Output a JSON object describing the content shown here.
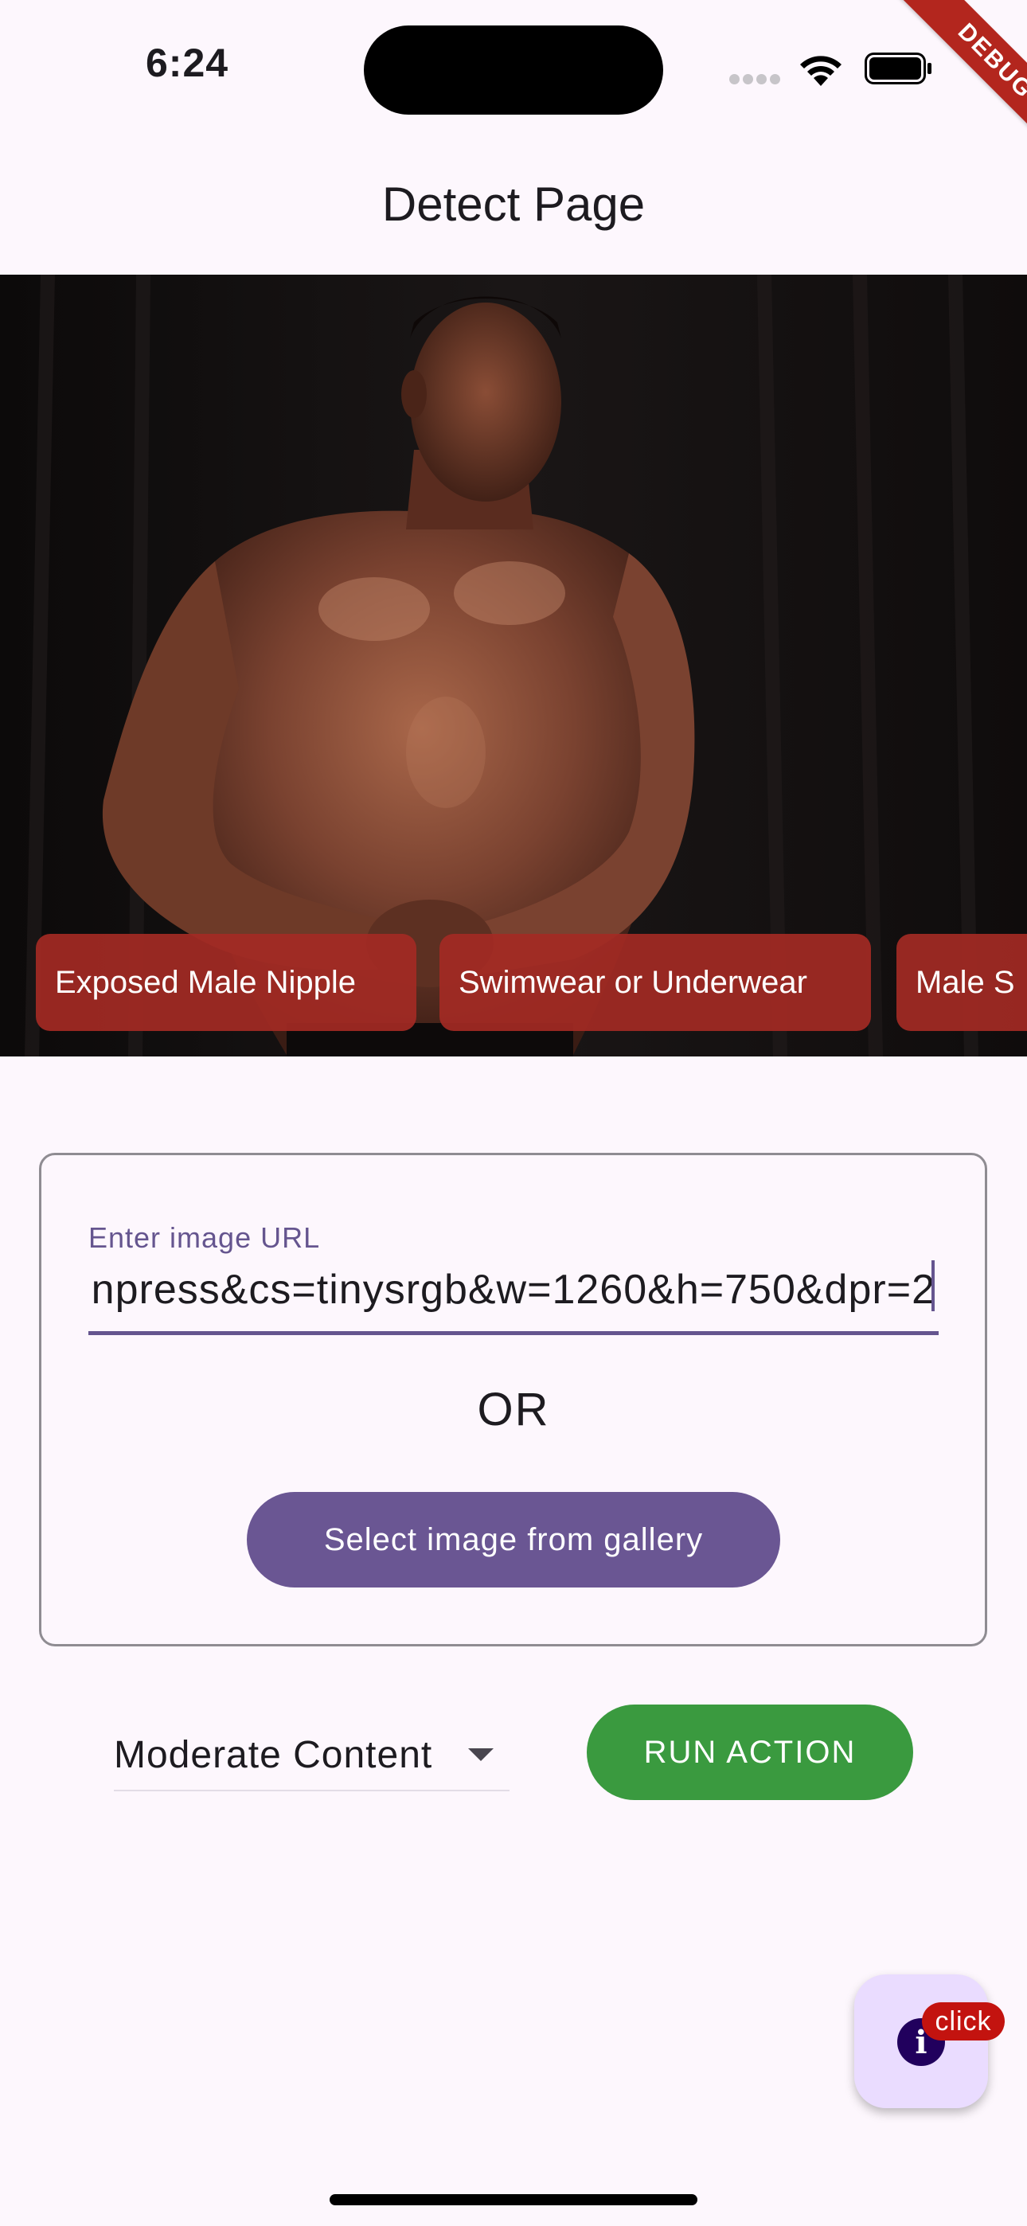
{
  "status_bar": {
    "time": "6:24",
    "icons": [
      "signal-dots",
      "wifi-icon",
      "battery-icon"
    ]
  },
  "debug_banner": "DEBUG",
  "app_bar": {
    "title": "Detect Page"
  },
  "image": {
    "description_icon": "photo",
    "detection_chips": [
      {
        "label": "Exposed Male Nipple"
      },
      {
        "label": "Swimwear or Underwear"
      },
      {
        "label": "Male S"
      }
    ]
  },
  "form": {
    "url_label": "Enter image URL",
    "url_value": "npress&cs=tinysrgb&w=1260&h=750&dpr=2",
    "or_text": "OR",
    "gallery_button": "Select image from gallery"
  },
  "controls": {
    "moderation_selected": "Moderate Content",
    "run_action_button": "RUN ACTION"
  },
  "fab": {
    "icon": "info-icon",
    "badge": "click"
  },
  "colors": {
    "background": "#fdf7fd",
    "primary": "#6a5693",
    "run_action": "#3a9a3f",
    "chip": "#a32a24",
    "badge": "#c3130f",
    "fab": "#eadcff"
  }
}
